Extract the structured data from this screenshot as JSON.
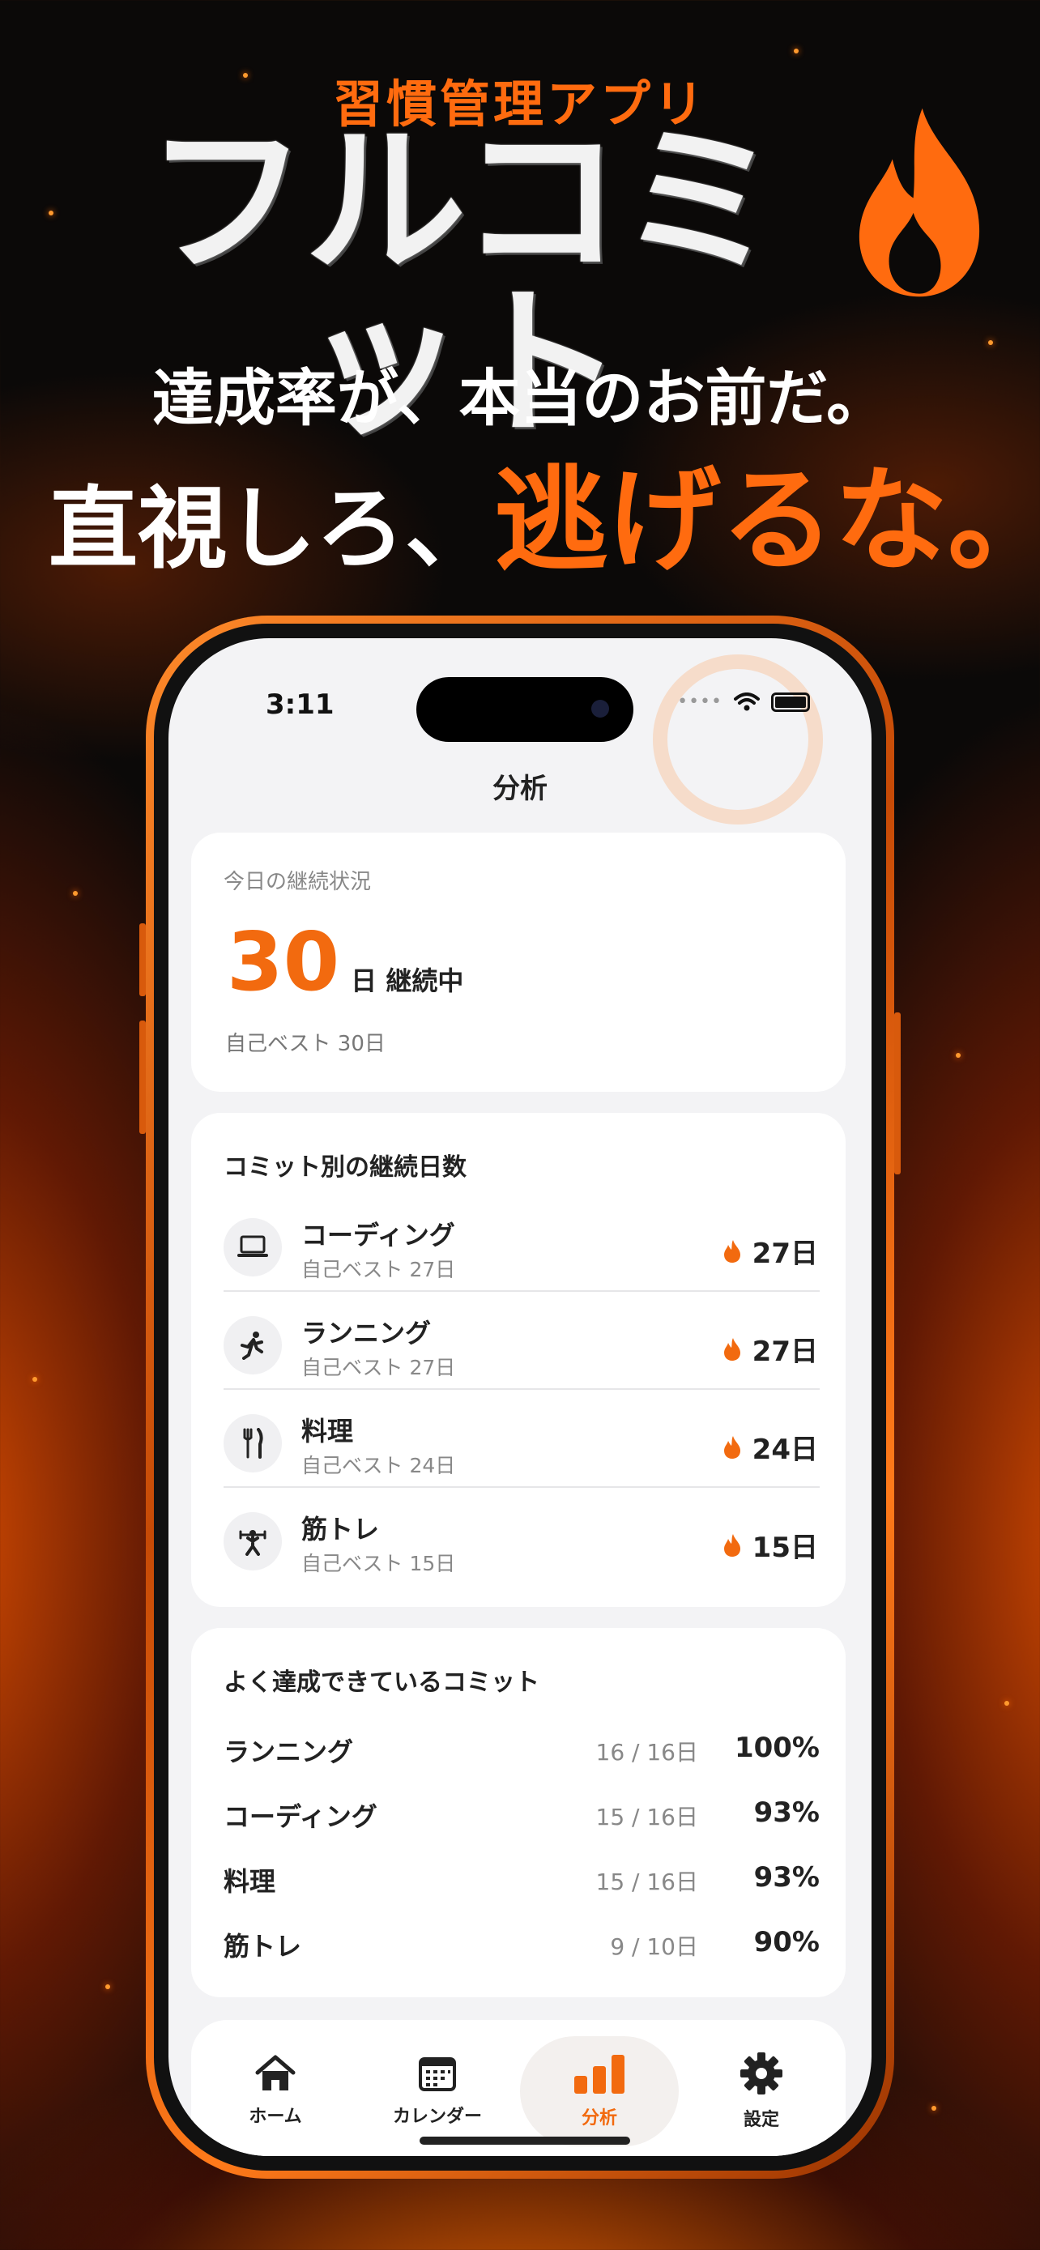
{
  "promo": {
    "tagline": "習慣管理アプリ",
    "app_name": "フルコミット",
    "copy_line1": "達成率が、本当のお前だ。",
    "copy_line2_prefix": "直視しろ、",
    "copy_line2_highlight": "逃げるな。"
  },
  "status_bar": {
    "time": "3:11"
  },
  "header": {
    "title": "分析"
  },
  "today": {
    "label": "今日の継続状況",
    "streak_value": "30",
    "streak_unit": "日 継続中",
    "personal_best": "自己ベスト 30日"
  },
  "streaks": {
    "title": "コミット別の継続日数",
    "items": [
      {
        "icon": "laptop-icon",
        "name": "コーディング",
        "best": "自己ベスト 27日",
        "days": "27日"
      },
      {
        "icon": "running-icon",
        "name": "ランニング",
        "best": "自己ベスト 27日",
        "days": "27日"
      },
      {
        "icon": "fork-knife-icon",
        "name": "料理",
        "best": "自己ベスト 24日",
        "days": "24日"
      },
      {
        "icon": "weightlifting-icon",
        "name": "筋トレ",
        "best": "自己ベスト 15日",
        "days": "15日"
      }
    ]
  },
  "achievement": {
    "title": "よく達成できているコミット",
    "items": [
      {
        "name": "ランニング",
        "fraction": "16 / 16日",
        "percent": "100%"
      },
      {
        "name": "コーディング",
        "fraction": "15 / 16日",
        "percent": "93%"
      },
      {
        "name": "料理",
        "fraction": "15 / 16日",
        "percent": "93%"
      },
      {
        "name": "筋トレ",
        "fraction": "9 / 10日",
        "percent": "90%"
      }
    ]
  },
  "tabs": [
    {
      "icon": "home-icon",
      "label": "ホーム",
      "active": false
    },
    {
      "icon": "calendar-icon",
      "label": "カレンダー",
      "active": false
    },
    {
      "icon": "bar-chart-icon",
      "label": "分析",
      "active": true
    },
    {
      "icon": "gear-icon",
      "label": "設定",
      "active": false
    }
  ],
  "colors": {
    "accent": "#f26a0f",
    "background": "#0b0908",
    "screen": "#f3f3f5"
  }
}
